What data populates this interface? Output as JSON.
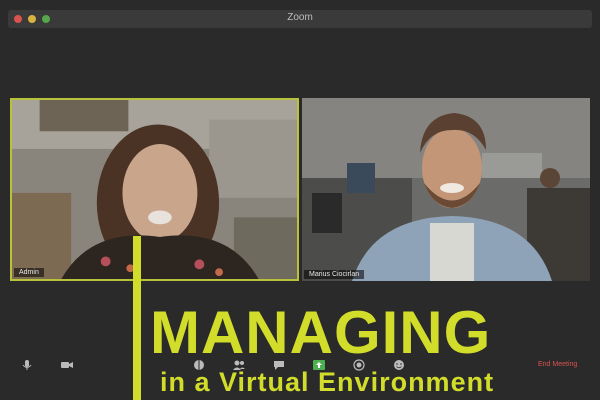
{
  "window": {
    "title": "Zoom"
  },
  "participants": [
    {
      "name": "Admin",
      "active_speaker": true
    },
    {
      "name": "Marius Ciocirlan",
      "active_speaker": false
    }
  ],
  "toolbar": {
    "end_meeting_label": "End Meeting",
    "icons": [
      "microphone-icon",
      "video-camera-icon",
      "security-icon",
      "participants-icon",
      "chat-icon",
      "share-screen-icon",
      "record-icon",
      "reactions-icon"
    ]
  },
  "overlay": {
    "headline": "MANAGING",
    "subline": "in a Virtual Environment"
  },
  "colors": {
    "accent": "#d2dc2a",
    "background": "#2a2a2a",
    "end_meeting": "#d9534f",
    "active_border": "#b8c23a"
  }
}
